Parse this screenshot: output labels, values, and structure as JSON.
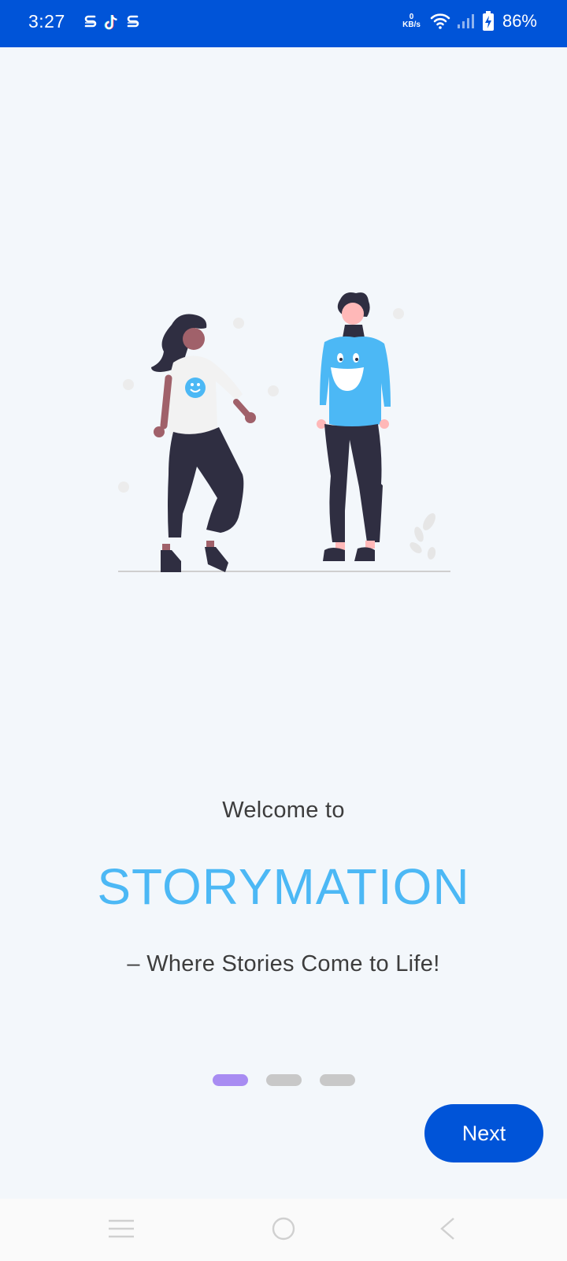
{
  "status_bar": {
    "time": "3:27",
    "net_speed_value": "0",
    "net_speed_unit": "KB/s",
    "battery_percent": "86%",
    "icons": [
      "s-app-icon",
      "tiktok-icon",
      "s-app-icon",
      "wifi-icon",
      "signal-icon",
      "battery-charging-icon"
    ],
    "background_color": "#0054d8"
  },
  "onboarding": {
    "welcome_text": "Welcome to",
    "brand_name": "STORYMATION",
    "tagline": "– Where Stories Come to Life!",
    "brand_color": "#4cb8f5",
    "page_indicator": {
      "total": 3,
      "current": 1,
      "active_color": "#a88cf2",
      "inactive_color": "#c8c8c8"
    },
    "next_label": "Next",
    "button_color": "#0054d8"
  },
  "navigation_bar": {
    "buttons": [
      "menu-icon",
      "home-icon",
      "back-icon"
    ]
  }
}
